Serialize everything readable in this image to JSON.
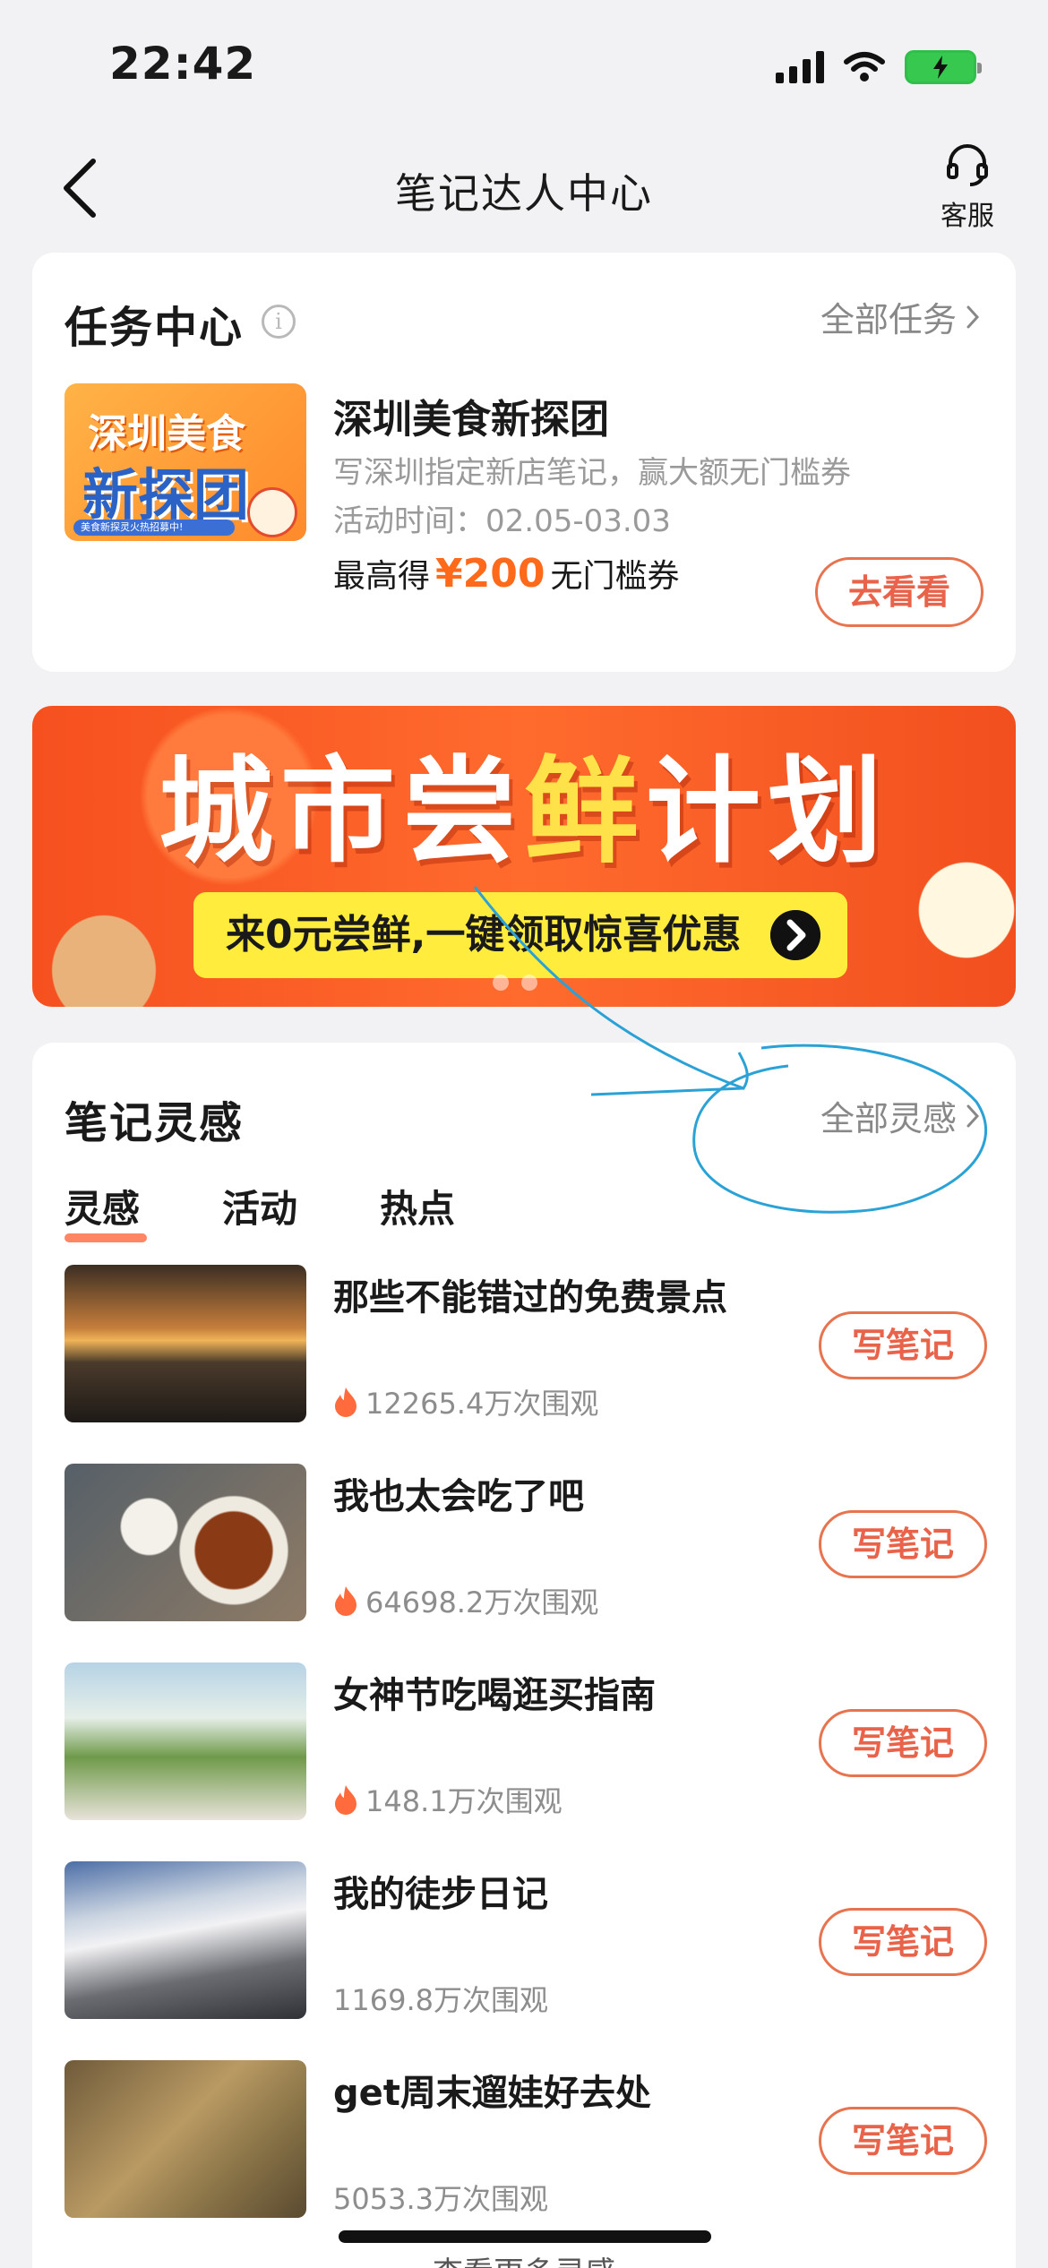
{
  "status_bar": {
    "time": "22:42"
  },
  "nav": {
    "title": "笔记达人中心",
    "service_label": "客服"
  },
  "task_center": {
    "title": "任务中心",
    "info_icon": "i",
    "more_label": "全部任务",
    "task": {
      "thumb_line1": "深圳美食",
      "thumb_line2": "新探团",
      "thumb_strip": "美食新探灵火热招募中!",
      "name": "深圳美食新探团",
      "desc": "写深圳指定新店笔记，赢大额无门槛券",
      "time": "活动时间：02.05-03.03",
      "reward_prefix": "最高得",
      "reward_amount": "¥200",
      "reward_suffix": "无门槛券",
      "button": "去看看"
    }
  },
  "banner": {
    "title_part1": "城市尝",
    "title_highlight": "鲜",
    "title_part2": "计划",
    "subtitle": "来0元尝鲜,一键领取惊喜优惠"
  },
  "inspiration": {
    "title": "笔记灵感",
    "more_label": "全部灵感",
    "tabs": [
      {
        "label": "灵感"
      },
      {
        "label": "活动"
      },
      {
        "label": "热点"
      }
    ],
    "items": [
      {
        "title": "那些不能错过的免费景点",
        "views": "12265.4万次围观",
        "hot": true,
        "button": "写笔记"
      },
      {
        "title": "我也太会吃了吧",
        "views": "64698.2万次围观",
        "hot": true,
        "button": "写笔记"
      },
      {
        "title": "女神节吃喝逛买指南",
        "views": "148.1万次围观",
        "hot": true,
        "button": "写笔记"
      },
      {
        "title": "我的徒步日记",
        "views": "1169.8万次围观",
        "hot": false,
        "button": "写笔记"
      },
      {
        "title": "get周末遛娃好去处",
        "views": "5053.3万次围观",
        "hot": false,
        "button": "写笔记"
      }
    ],
    "bottom_hint": "查看更多灵感"
  },
  "colors": {
    "accent": "#e8634a",
    "banner": "#f6501f",
    "highlight": "#ffe14a",
    "scribble": "#2aa2d6"
  }
}
